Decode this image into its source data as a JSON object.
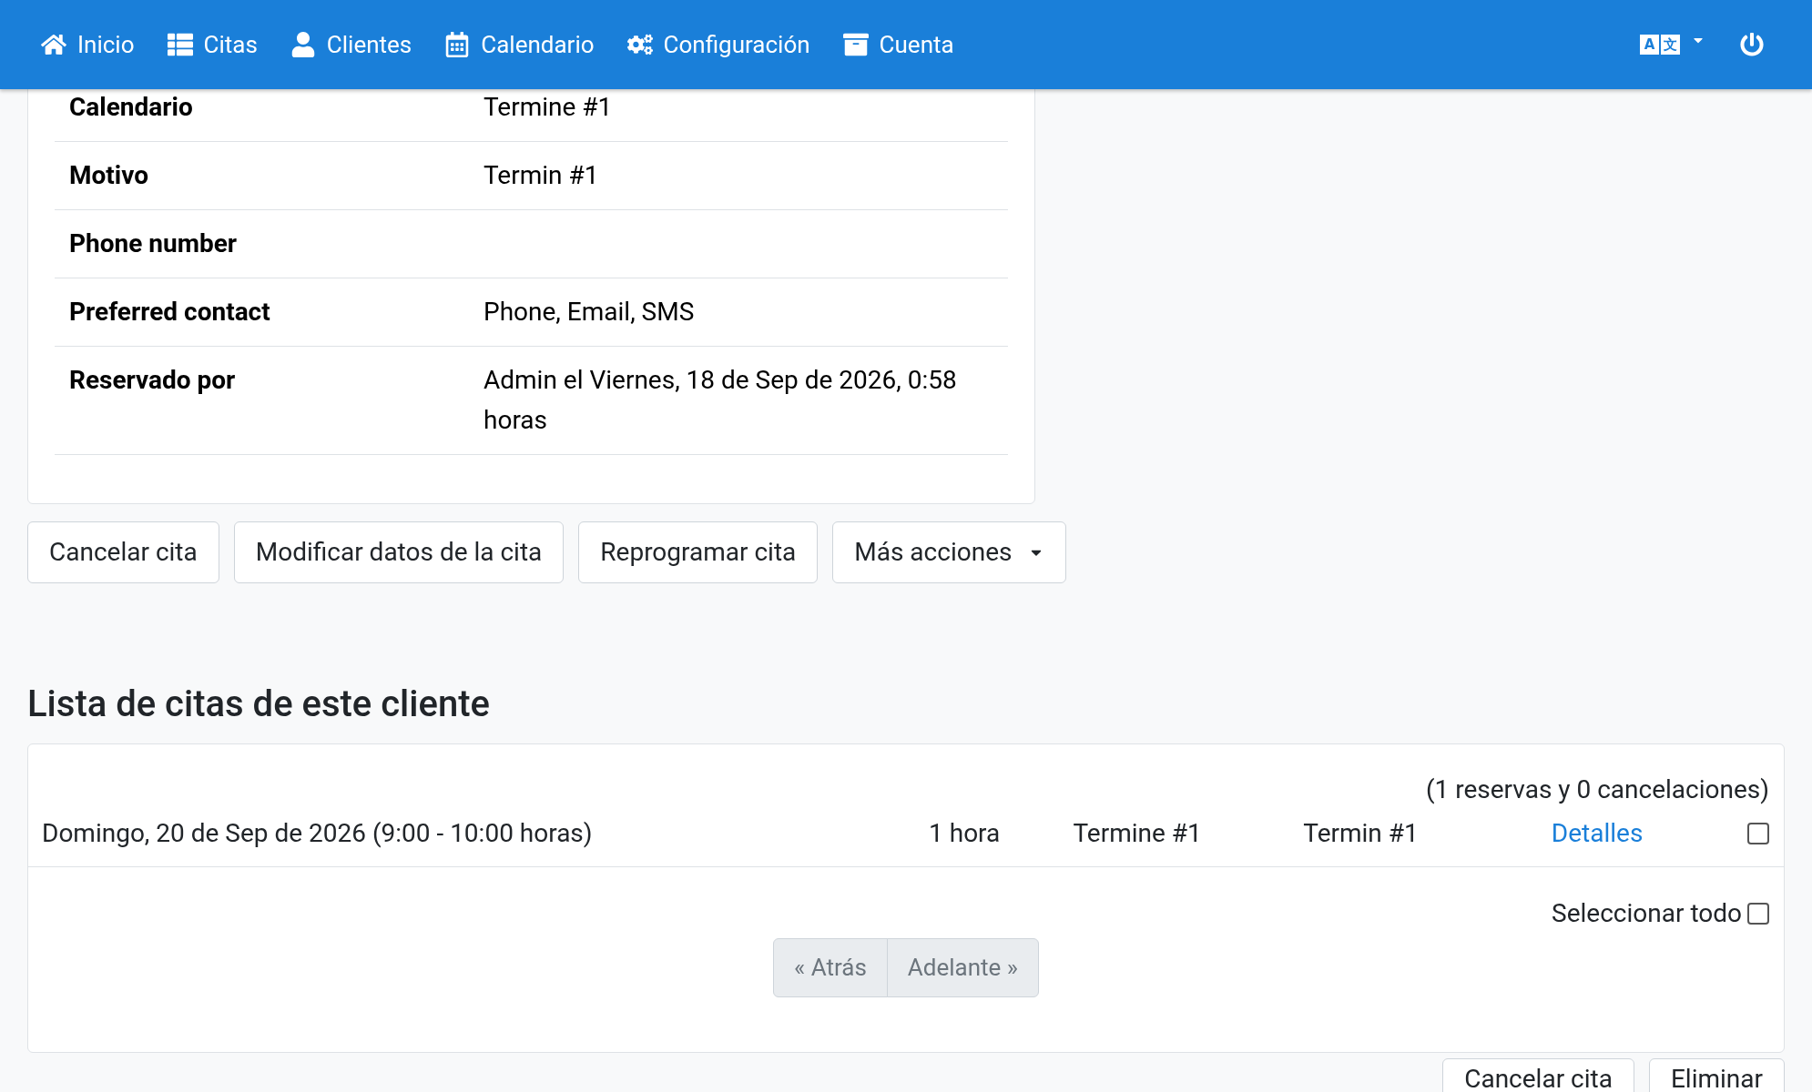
{
  "nav": {
    "items": [
      {
        "label": "Inicio"
      },
      {
        "label": "Citas"
      },
      {
        "label": "Clientes"
      },
      {
        "label": "Calendario"
      },
      {
        "label": "Configuración"
      },
      {
        "label": "Cuenta"
      }
    ],
    "language": {
      "letters": [
        "A",
        "文"
      ]
    }
  },
  "details": {
    "rows": [
      {
        "label": "Calendario",
        "value": "Termine #1"
      },
      {
        "label": "Motivo",
        "value": "Termin #1"
      },
      {
        "label": "Phone number"
      },
      {
        "label": "Preferred contact",
        "value": "Phone, Email, SMS"
      },
      {
        "label": "Reservado por",
        "value": "Admin el Viernes, 18 de Sep de 2026, 0:58 horas"
      }
    ]
  },
  "actions": [
    {
      "label": "Cancelar cita",
      "kind": "plain"
    },
    {
      "label": "Modificar datos de la cita",
      "kind": "plain"
    },
    {
      "label": "Reprogramar cita",
      "kind": "plain"
    },
    {
      "label": "Más acciones",
      "kind": "dropdown"
    }
  ],
  "appointments": {
    "title": "Lista de citas de este cliente",
    "summary": "(1 reservas y 0 cancelaciones)",
    "rows": [
      {
        "date": "Domingo, 20 de Sep de 2026 (9:00 - 10:00 horas)",
        "duration": "1 hora",
        "calendar": "Termine #1",
        "reason": "Termin #1",
        "link": "Detalles",
        "checked": false
      }
    ],
    "select_all": {
      "label": "Seleccionar todo",
      "checked": false
    },
    "pagination": [
      {
        "label": "« Atrás",
        "disabled": true
      },
      {
        "label": "Adelante »",
        "disabled": true
      }
    ],
    "bottom_actions": [
      {
        "label": "Cancelar cita"
      },
      {
        "label": "Eliminar"
      }
    ]
  }
}
